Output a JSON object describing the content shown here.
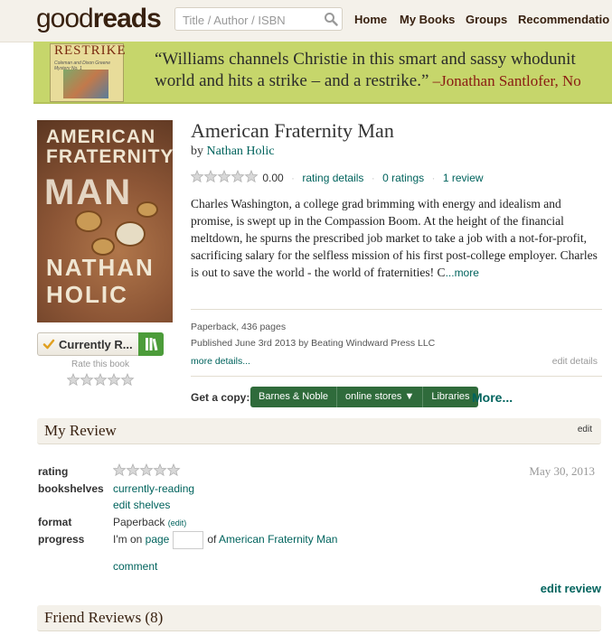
{
  "header": {
    "logo_good": "good",
    "logo_reads": "reads",
    "search_placeholder": "Title / Author / ISBN",
    "nav": [
      "Home",
      "My Books",
      "Groups",
      "Recommendatio"
    ]
  },
  "banner": {
    "book_title": "RESTRIKE",
    "book_series": "Coleman and Dixon Greene Mystery No. 1",
    "quote_line1": "“Williams channels Christie in this smart and sassy whodunit",
    "quote_line2": "world and hits a strike – and a restrike.”",
    "quote_attribution": " –Jonathan Santlofer, No"
  },
  "cover": {
    "title": "AMERICAN FRATERNITY MAN",
    "title_line1": "AMERICAN",
    "title_line2": "FRATERNITY",
    "title_line3": "MAN",
    "author_line1": "NATHAN",
    "author_line2": "HOLIC"
  },
  "book": {
    "title": "American Fraternity Man",
    "by": "by",
    "author": "Nathan Holic",
    "avg_rating": "0.00",
    "rating_details": "rating details",
    "ratings": "0 ratings",
    "reviews": "1 review",
    "description": "Charles Washington, a college grad brimming with energy and idealism and promise, is swept up in the Compassion Boom. At the height of the financial meltdown, he spurns the prescribed job market to take a job with a not-for-profit, sacrificing salary for the selfless mission of his first post-college employer. Charles is out to save the world - the world of fraternities! C",
    "description_more": "...more",
    "format": "Paperback, 436 pages",
    "published": "Published June 3rd 2013 by Beating Windward Press LLC",
    "more_details": "more details...",
    "edit_details": "edit details"
  },
  "shelf_button": {
    "label": "Currently R...",
    "rate_label": "Rate this book"
  },
  "get_copy": {
    "label": "Get a copy:",
    "stores": [
      "Barnes & Noble",
      "online stores ▼",
      "Libraries"
    ],
    "more": "More..."
  },
  "my_review": {
    "heading": "My Review",
    "edit": "edit",
    "rating_label": "rating",
    "bookshelves_label": "bookshelves",
    "shelf": "currently-reading",
    "edit_shelves": "edit shelves",
    "format_label": "format",
    "format_value": "Paperback",
    "format_edit": "(edit)",
    "progress_label": "progress",
    "progress_prefix": "I'm on",
    "progress_page": "page",
    "progress_of": "of",
    "progress_book": "American Fraternity Man",
    "comment": "comment",
    "date": "May 30, 2013",
    "edit_review": "edit review"
  },
  "friend_reviews": {
    "heading": "Friend Reviews (8)"
  },
  "colors": {
    "brand_brown": "#382110",
    "link_green": "#00635d",
    "header_bg": "#f4f1ea",
    "banner_bg": "#c6d66b",
    "store_button": "#2f6b3b"
  }
}
